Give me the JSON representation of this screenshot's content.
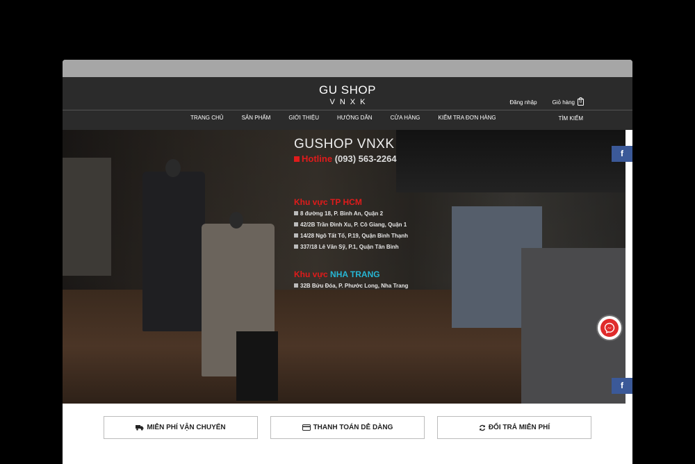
{
  "header": {
    "logo_main": "GU SHOP",
    "logo_sub": "VNXK",
    "login": "Đăng nhập",
    "cart": "Giỏ hàng",
    "cart_count": "0",
    "search": "TÌM KIẾM"
  },
  "nav": {
    "items": [
      {
        "label": "TRANG CHỦ"
      },
      {
        "label": "SẢN PHẨM"
      },
      {
        "label": "GIỚI THIỆU"
      },
      {
        "label": "HƯỚNG DẪN"
      },
      {
        "label": "CỬA HÀNG"
      },
      {
        "label": "KIỂM TRA ĐƠN HÀNG"
      }
    ]
  },
  "hero": {
    "title": "GUSHOP VNXK",
    "hotline_label": "Hotline",
    "hotline_number": "(093) 563-2264",
    "region1": {
      "prefix": "Khu vực",
      "city": "TP HCM",
      "addresses": [
        "8 đường 18, P. Bình An, Quận 2",
        "42/2B Trần Đình Xu, P. Cô Giang, Quận 1",
        "14/28 Ngô Tất Tố, P.19, Quận Bình Thạnh",
        "337/18 Lê Văn Sỹ, P.1, Quận Tân Bình"
      ]
    },
    "region2": {
      "prefix": "Khu vực",
      "city": "NHA TRANG",
      "addresses": [
        "32B Bửu Đóa, P. Phước Long, Nha Trang"
      ]
    }
  },
  "social": {
    "facebook_label": "f",
    "messenger_label": "~"
  },
  "features": [
    {
      "label": "MIỄN PHÍ VẬN CHUYỂN",
      "icon": "truck-icon"
    },
    {
      "label": "THANH TOÁN DỄ DÀNG",
      "icon": "credit-card-icon"
    },
    {
      "label": "ĐỔI TRẢ MIỄN PHÍ",
      "icon": "refresh-icon"
    }
  ],
  "colors": {
    "header_bg": "#2b2b2b",
    "accent_red": "#e01b1b",
    "accent_blue": "#27b6d4",
    "facebook": "#3b5998"
  }
}
